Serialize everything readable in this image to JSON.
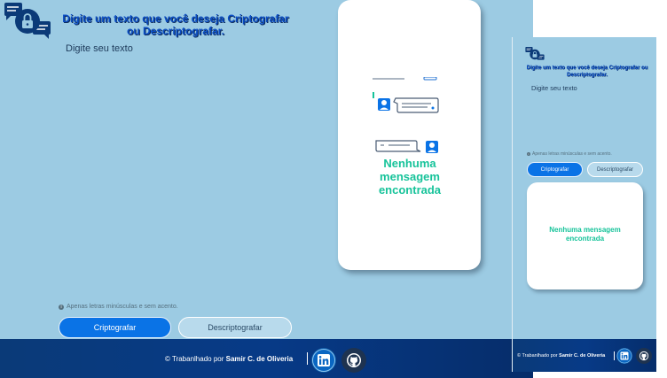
{
  "app": {
    "title_line1": "Digite um texto que você deseja Criptografar",
    "title_line2": "ou Descriptografar.",
    "title_mobile_line1": "Digite um texto que você deseja Criptografar ou",
    "title_mobile_line2": "Descriptografar."
  },
  "input": {
    "placeholder": "Digite seu texto"
  },
  "hint": {
    "icon": "info-icon",
    "text": "Apenas letras minúsculas e sem acento."
  },
  "buttons": {
    "encrypt_label": "Criptografar",
    "decrypt_label": "Descriptografar"
  },
  "output": {
    "empty_line1": "Nenhuma",
    "empty_line2": "mensagem",
    "empty_line3": "encontrada",
    "empty_mobile_line1": "Nenhuma mensagem",
    "empty_mobile_line2": "encontrada"
  },
  "footer": {
    "prefix": "© Trabanlhado por",
    "author": "Samir C. de Oliveria",
    "linkedin_icon": "linkedin-icon",
    "github_icon": "github-icon"
  },
  "colors": {
    "background": "#9ccbe3",
    "primary": "#0a73e6",
    "title": "#0a4dc4",
    "accent": "#17c39a",
    "footer": "#073a87"
  }
}
